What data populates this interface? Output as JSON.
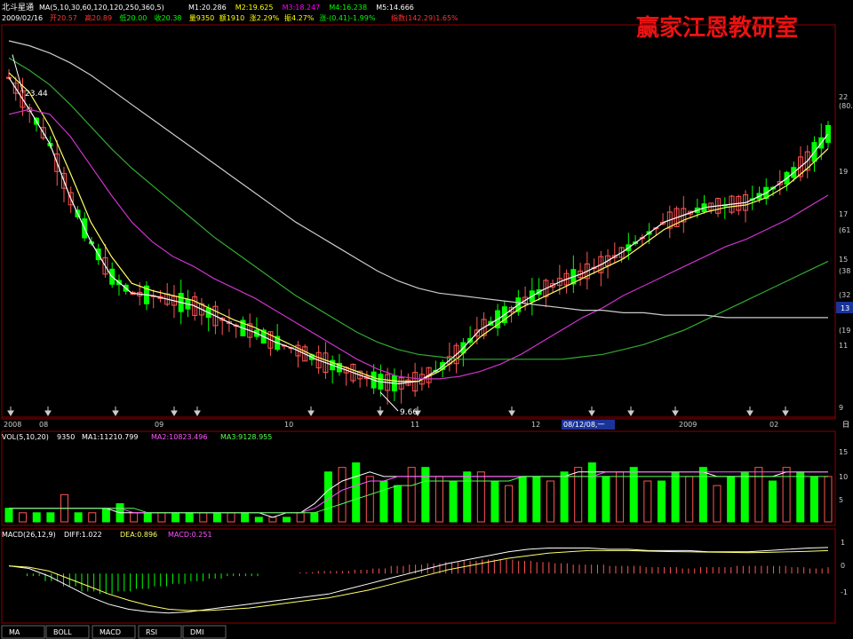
{
  "header": {
    "stock_name": "北斗星通",
    "ma_param": "MA(5,10,30,60,120,120,250,360,5)",
    "ma_values": [
      {
        "label": "M1:20.286",
        "color": "#ffffff"
      },
      {
        "label": "M2:19.625",
        "color": "#ffff00"
      },
      {
        "label": "M3:18.247",
        "color": "#ff00ff"
      },
      {
        "label": "M4:16.238",
        "color": "#00ff00"
      },
      {
        "label": "M5:14.666",
        "color": "#ffffff"
      }
    ],
    "date": "2009/02/16",
    "quote": [
      {
        "label": "开20.57",
        "color": "#ff3333"
      },
      {
        "label": "高20.89",
        "color": "#ff3333"
      },
      {
        "label": "低20.00",
        "color": "#00ff00"
      },
      {
        "label": "收20.38",
        "color": "#00ff00"
      },
      {
        "label": "量9350",
        "color": "#ffff00"
      },
      {
        "label": "额1910",
        "color": "#ffff00"
      },
      {
        "label": "涨2.29%",
        "color": "#ffff00"
      },
      {
        "label": "振4.27%",
        "color": "#ffff00"
      },
      {
        "label": "涨-(0.41)-1.99%",
        "color": "#00ff00"
      },
      {
        "label": "指数(142.29)1.65%",
        "color": "#ff3333"
      }
    ],
    "watermark": "赢家江恩教研室"
  },
  "price_panel": {
    "y_labels": [
      "22",
      "(80.",
      "19",
      "17",
      "(61",
      "15",
      "(38",
      "(32",
      "13",
      "(19",
      "11",
      "9"
    ],
    "current_price_box": "13",
    "x_labels": [
      "2008",
      "08",
      "09",
      "10",
      "11",
      "12",
      "2009",
      "02"
    ],
    "date_box": "08/12/08,一",
    "high_annotation": "23.44",
    "low_annotation": "9.66",
    "corner_label": "日"
  },
  "vol_panel": {
    "title": "VOL(5,10,20)",
    "value": "9350",
    "ma1": "MA1:11210.799",
    "ma2": "MA2:10823.496",
    "ma3": "MA3:9128.955",
    "y_labels": [
      "15",
      "10",
      "5"
    ]
  },
  "macd_panel": {
    "title": "MACD(26,12,9)",
    "diff": "DIFF:1.022",
    "dea": "DEA:0.896",
    "macd": "MACD:0.251",
    "y_labels": [
      "1",
      "0",
      "-1"
    ]
  },
  "tabs": [
    "MA",
    "BOLL",
    "MACD",
    "RSI",
    "DMI"
  ],
  "colors": {
    "up": "#ff5555",
    "down": "#00ff00",
    "grid": "#8b0000",
    "axis_text": "#cccccc",
    "ma_white": "#ffffff",
    "ma_yellow": "#ffff66",
    "ma_magenta": "#cc33cc",
    "ma_green": "#33aa33",
    "ma_gray": "#cccccc"
  },
  "chart_data": [
    {
      "type": "candlestick",
      "title": "北斗星通",
      "ylim": [
        9,
        24
      ],
      "annotations": [
        {
          "text": "23.44",
          "value": 23.44
        },
        {
          "text": "9.66",
          "value": 9.66
        }
      ],
      "series": [
        {
          "name": "M1",
          "values": [
            22.5,
            21.2,
            19.8,
            17.6,
            15.8,
            14.4,
            13.7,
            13.6,
            13.4,
            13.2,
            12.8,
            12.4,
            12.1,
            11.7,
            11.4,
            11.0,
            10.7,
            10.4,
            10.1,
            10.0,
            10.1,
            10.6,
            11.3,
            12.2,
            12.7,
            13.3,
            13.8,
            14.2,
            14.5,
            14.9,
            15.4,
            16.0,
            16.6,
            16.9,
            17.2,
            17.3,
            17.4,
            17.8,
            18.4,
            19.1,
            20.2
          ]
        },
        {
          "name": "M2",
          "values": [
            22.7,
            21.9,
            20.5,
            18.6,
            16.6,
            15.2,
            14.1,
            13.8,
            13.6,
            13.4,
            13.0,
            12.6,
            12.3,
            11.9,
            11.5,
            11.1,
            10.8,
            10.5,
            10.2,
            10.1,
            10.1,
            10.5,
            11.1,
            11.9,
            12.5,
            13.1,
            13.5,
            13.9,
            14.3,
            14.7,
            15.1,
            15.7,
            16.3,
            16.7,
            17.0,
            17.2,
            17.3,
            17.6,
            18.1,
            18.8,
            19.6
          ]
        },
        {
          "name": "M3",
          "values": [
            21.0,
            21.2,
            21.0,
            20.1,
            18.9,
            17.7,
            16.6,
            15.8,
            15.2,
            14.8,
            14.3,
            13.9,
            13.5,
            13.0,
            12.5,
            12.0,
            11.5,
            11.0,
            10.6,
            10.3,
            10.2,
            10.2,
            10.3,
            10.5,
            10.8,
            11.2,
            11.7,
            12.2,
            12.7,
            13.1,
            13.6,
            14.0,
            14.4,
            14.8,
            15.2,
            15.6,
            15.9,
            16.3,
            16.7,
            17.2,
            17.7
          ]
        },
        {
          "name": "M4",
          "values": [
            23.3,
            22.8,
            22.2,
            21.4,
            20.5,
            19.6,
            18.8,
            18.1,
            17.4,
            16.7,
            16.0,
            15.4,
            14.8,
            14.2,
            13.6,
            13.1,
            12.6,
            12.1,
            11.7,
            11.4,
            11.2,
            11.1,
            11.0,
            11.0,
            11.0,
            11.0,
            11.0,
            11.0,
            11.1,
            11.2,
            11.4,
            11.6,
            11.9,
            12.2,
            12.6,
            13.0,
            13.4,
            13.8,
            14.2,
            14.6,
            15.0
          ]
        },
        {
          "name": "M5",
          "values": [
            24.0,
            23.8,
            23.5,
            23.1,
            22.6,
            22.0,
            21.4,
            20.8,
            20.2,
            19.6,
            19.0,
            18.4,
            17.8,
            17.2,
            16.6,
            16.1,
            15.6,
            15.1,
            14.6,
            14.2,
            13.9,
            13.7,
            13.6,
            13.5,
            13.4,
            13.3,
            13.2,
            13.1,
            13.0,
            13.0,
            12.9,
            12.9,
            12.8,
            12.8,
            12.8,
            12.7,
            12.7,
            12.7,
            12.7,
            12.7,
            12.7
          ]
        }
      ]
    },
    {
      "type": "bar",
      "title": "VOL(5,10,20)",
      "ylim": [
        0,
        18
      ],
      "values": [
        3,
        2,
        2,
        2,
        6,
        2,
        2,
        3,
        4,
        2,
        2,
        2,
        2,
        2,
        2,
        2,
        2,
        2,
        1,
        1,
        1,
        2,
        2,
        11,
        12,
        13,
        10,
        9,
        8,
        12,
        12,
        10,
        9,
        11,
        11,
        9,
        8,
        10,
        10,
        9,
        11,
        12,
        13,
        10,
        11,
        12,
        9,
        9,
        11,
        10,
        12,
        8,
        10,
        11,
        12,
        9,
        12,
        11,
        10,
        10
      ],
      "series": [
        {
          "name": "MA1",
          "values": [
            3,
            3,
            3,
            3,
            3,
            3,
            3,
            3,
            2,
            2,
            2,
            2,
            2,
            2,
            2,
            2,
            2,
            2,
            2,
            1,
            2,
            2,
            4,
            7,
            9,
            10,
            11,
            10,
            10,
            10,
            10,
            10,
            10,
            10,
            10,
            10,
            10,
            10,
            10,
            10,
            10,
            11,
            11,
            11,
            11,
            11,
            11,
            11,
            11,
            11,
            11,
            10,
            10,
            10,
            10,
            10,
            11,
            11,
            11,
            11
          ]
        },
        {
          "name": "MA2",
          "values": [
            3,
            3,
            3,
            3,
            3,
            3,
            3,
            3,
            3,
            2,
            2,
            2,
            2,
            2,
            2,
            2,
            2,
            2,
            2,
            2,
            2,
            2,
            3,
            5,
            7,
            8,
            9,
            9,
            10,
            10,
            10,
            10,
            10,
            10,
            10,
            10,
            10,
            10,
            10,
            10,
            10,
            10,
            10,
            11,
            11,
            11,
            11,
            11,
            11,
            11,
            11,
            11,
            11,
            11,
            11,
            11,
            11,
            11,
            11,
            11
          ]
        },
        {
          "name": "MA3",
          "values": [
            3,
            3,
            3,
            3,
            3,
            3,
            3,
            3,
            3,
            3,
            2,
            2,
            2,
            2,
            2,
            2,
            2,
            2,
            2,
            2,
            2,
            2,
            2,
            3,
            4,
            5,
            6,
            7,
            8,
            8,
            9,
            9,
            9,
            9,
            9,
            9,
            9,
            10,
            10,
            10,
            10,
            10,
            10,
            10,
            10,
            10,
            10,
            10,
            10,
            10,
            10,
            10,
            10,
            10,
            10,
            10,
            10,
            10,
            10,
            10
          ]
        }
      ]
    },
    {
      "type": "bar",
      "title": "MACD(26,12,9)",
      "ylim": [
        -1.8,
        1.4
      ],
      "values": [
        0,
        -0.1,
        -0.3,
        -0.5,
        -0.7,
        -0.8,
        -0.7,
        -0.6,
        -0.5,
        -0.4,
        -0.3,
        -0.2,
        -0.1,
        -0.1,
        0,
        0,
        0.05,
        0.1,
        0.1,
        0.15,
        0.2,
        0.3,
        0.35,
        0.4,
        0.45,
        0.5,
        0.55,
        0.55,
        0.5,
        0.45,
        0.4,
        0.35,
        0.35,
        0.3,
        0.3,
        0.25,
        0.25,
        0.2,
        0.25,
        0.25,
        0.3,
        0.3,
        0.3,
        0.25,
        0.2,
        0.25
      ],
      "series": [
        {
          "name": "DIFF",
          "values": [
            0.3,
            0.2,
            -0.1,
            -0.5,
            -0.9,
            -1.2,
            -1.4,
            -1.5,
            -1.55,
            -1.5,
            -1.4,
            -1.3,
            -1.2,
            -1.1,
            -1.0,
            -0.9,
            -0.8,
            -0.6,
            -0.4,
            -0.2,
            0.0,
            0.2,
            0.4,
            0.55,
            0.7,
            0.85,
            0.95,
            1.0,
            1.0,
            1.0,
            0.95,
            0.95,
            0.9,
            0.9,
            0.9,
            0.85,
            0.85,
            0.85,
            0.9,
            0.95,
            1.0,
            1.02
          ]
        },
        {
          "name": "DEA",
          "values": [
            0.3,
            0.25,
            0.1,
            -0.2,
            -0.5,
            -0.8,
            -1.05,
            -1.25,
            -1.4,
            -1.45,
            -1.45,
            -1.4,
            -1.35,
            -1.25,
            -1.15,
            -1.05,
            -0.95,
            -0.8,
            -0.65,
            -0.45,
            -0.25,
            -0.05,
            0.15,
            0.3,
            0.45,
            0.6,
            0.7,
            0.8,
            0.85,
            0.9,
            0.9,
            0.9,
            0.88,
            0.86,
            0.85,
            0.84,
            0.83,
            0.82,
            0.83,
            0.85,
            0.87,
            0.9
          ]
        }
      ]
    }
  ]
}
